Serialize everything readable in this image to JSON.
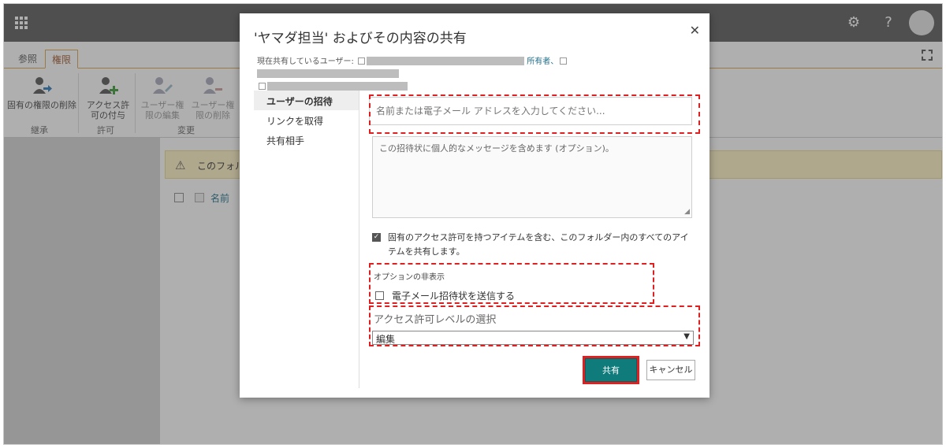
{
  "ribbon": {
    "tabs": [
      "参照",
      "権限"
    ],
    "buttons": [
      {
        "label": "固有の権限の削除"
      },
      {
        "label": "アクセス許可の付与"
      },
      {
        "label": "ユーザー権限の編集"
      },
      {
        "label": "ユーザー権限の削除"
      }
    ],
    "groups": [
      "継承",
      "許可",
      "変更"
    ]
  },
  "page": {
    "warning_text": "このフォルダ",
    "list_header_name": "名前"
  },
  "dialog": {
    "title": "'ヤマダ担当' およびその内容の共有",
    "close_glyph": "✕",
    "shared_with_label": "現在共有しているユーザー:",
    "owner_label": "所有者、",
    "nav": [
      "ユーザーの招待",
      "リンクを取得",
      "共有相手"
    ],
    "name_placeholder": "名前または電子メール アドレスを入力してください...",
    "message_placeholder": "この招待状に個人的なメッセージを含めます (オプション)。",
    "include_items_text": "固有のアクセス許可を持つアイテムを含む、このフォルダー内のすべてのアイテムを共有します。",
    "include_items_checked": true,
    "hide_options_link": "オプションの非表示",
    "send_email_label": "電子メール招待状を送信する",
    "send_email_checked": false,
    "permission_level_label": "アクセス許可レベルの選択",
    "permission_level_value": "編集",
    "share_button": "共有",
    "cancel_button": "キャンセル"
  },
  "colors": {
    "suitebar": "#5a5a5a",
    "accent": "#107b7b",
    "highlight": "#e02020"
  }
}
